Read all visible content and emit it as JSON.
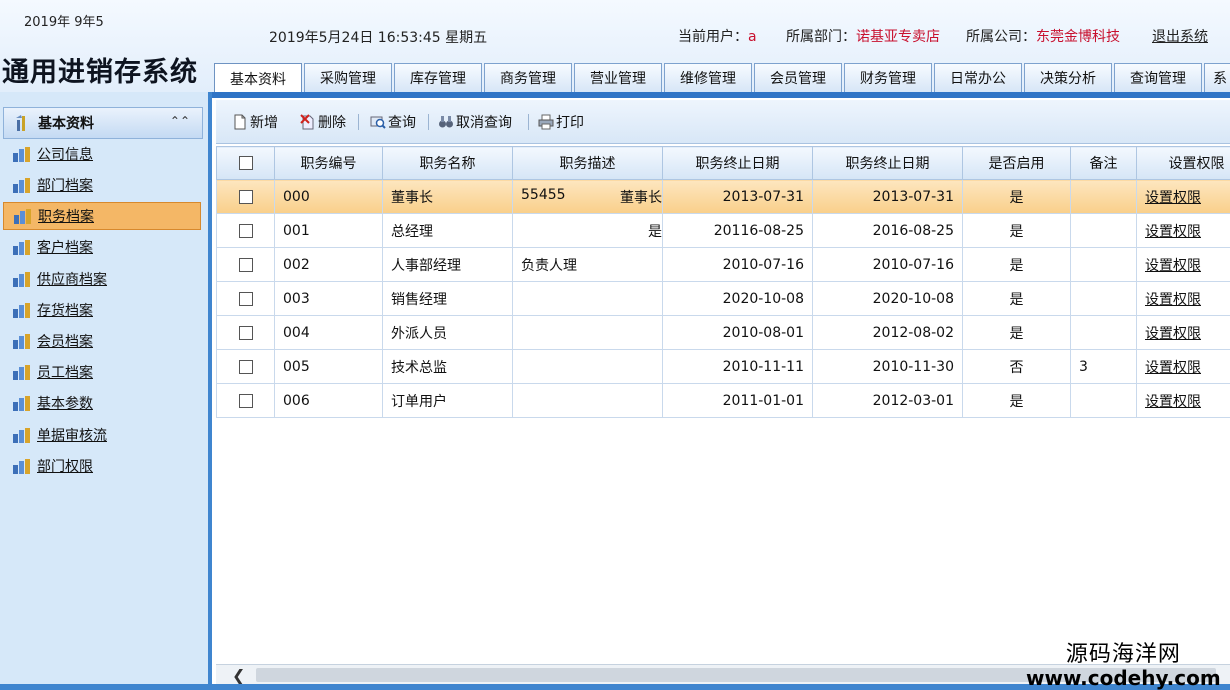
{
  "header": {
    "version": "2019年 9年5",
    "app_title": "通用进销存系统",
    "datetime": "2019年5月24日  16:53:45  星期五",
    "current_user_label": "当前用户：",
    "current_user": "a",
    "department_label": "所属部门：",
    "department": "诺基亚专卖店",
    "company_label": "所属公司：",
    "company": "东莞金博科技",
    "logout": "退出系统",
    "accent_red": "#c8102e"
  },
  "tabs": [
    {
      "label": "基本资料",
      "active": true
    },
    {
      "label": "采购管理"
    },
    {
      "label": "库存管理"
    },
    {
      "label": "商务管理"
    },
    {
      "label": "营业管理"
    },
    {
      "label": "维修管理"
    },
    {
      "label": "会员管理"
    },
    {
      "label": "财务管理"
    },
    {
      "label": "日常办公"
    },
    {
      "label": "决策分析"
    },
    {
      "label": "查询管理"
    },
    {
      "label": "系"
    }
  ],
  "sidebar": {
    "header": "基本资料",
    "items": [
      {
        "label": "公司信息"
      },
      {
        "label": "部门档案"
      },
      {
        "label": "职务档案",
        "active": true
      },
      {
        "label": "客户档案"
      },
      {
        "label": "供应商档案"
      },
      {
        "label": "存货档案"
      },
      {
        "label": "会员档案"
      },
      {
        "label": "员工档案"
      },
      {
        "label": "基本参数"
      },
      {
        "label": "单据审核流"
      },
      {
        "label": "部门权限"
      }
    ]
  },
  "toolbar": {
    "add": "新增",
    "delete": "删除",
    "query": "查询",
    "cancel_query": "取消查询",
    "print": "打印"
  },
  "grid": {
    "columns": [
      "职务编号",
      "职务名称",
      "职务描述",
      "职务终止日期",
      "职务终止日期",
      "是否启用",
      "备注",
      "设置权限"
    ],
    "rows": [
      {
        "code": "000",
        "name": "董事长",
        "desc": "55455",
        "extra": "董事长",
        "date1": "2013-07-31",
        "date2": "2013-07-31",
        "enabled": "是",
        "note": "",
        "action": "设置权限",
        "selected": true
      },
      {
        "code": "001",
        "name": "总经理",
        "desc": "",
        "extra": "是",
        "date1": "20116-08-25",
        "date2": "2016-08-25",
        "enabled": "是",
        "note": "",
        "action": "设置权限"
      },
      {
        "code": "002",
        "name": "人事部经理",
        "desc": "负责人理",
        "extra": "",
        "date1": "2010-07-16",
        "date2": "2010-07-16",
        "enabled": "是",
        "note": "",
        "action": "设置权限"
      },
      {
        "code": "003",
        "name": "销售经理",
        "desc": "",
        "extra": "",
        "date1": "2020-10-08",
        "date2": "2020-10-08",
        "enabled": "是",
        "note": "",
        "action": "设置权限"
      },
      {
        "code": "004",
        "name": "外派人员",
        "desc": "",
        "extra": "",
        "date1": "2010-08-01",
        "date2": "2012-08-02",
        "enabled": "是",
        "note": "",
        "action": "设置权限"
      },
      {
        "code": "005",
        "name": "技术总监",
        "desc": "",
        "extra": "",
        "date1": "2010-11-11",
        "date2": "2010-11-30",
        "enabled": "否",
        "note": "3",
        "action": "设置权限"
      },
      {
        "code": "006",
        "name": "订单用户",
        "desc": "",
        "extra": "",
        "date1": "2011-01-01",
        "date2": "2012-03-01",
        "enabled": "是",
        "note": "",
        "action": "设置权限"
      }
    ]
  },
  "watermark": {
    "line1": "源码海洋网",
    "line2": "www.codehy.com"
  },
  "colors": {
    "tab_underline": "#2f74c6",
    "sidebar_bg": "#d6e8f9",
    "selected_row": "#f9cf8a",
    "active_side_item": "#f4b766"
  }
}
